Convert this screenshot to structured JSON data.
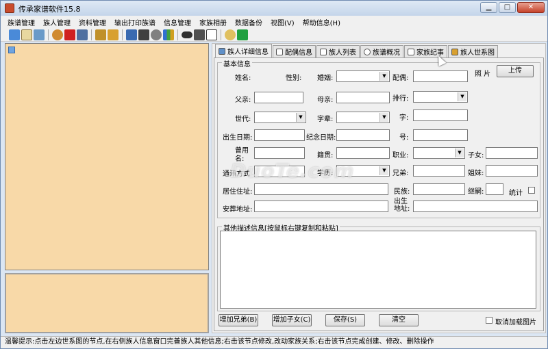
{
  "window": {
    "title": "传承家谱软件15.8",
    "minimize": "▁",
    "maximize": "□",
    "close": "✕"
  },
  "menu": [
    "族谱管理",
    "族人管理",
    "资料管理",
    "输出打印族谱",
    "信息管理",
    "家族相册",
    "数据备份",
    "视图(V)",
    "帮助信息(H)"
  ],
  "toolbar_icons": [
    "tree-icon",
    "book-icon",
    "page-icon",
    "add-person-icon",
    "delete-icon",
    "edit-icon",
    "link-icon",
    "people-icon",
    "print-icon",
    "binoculars-icon",
    "settings-icon",
    "chart-icon",
    "eye-icon",
    "books-icon",
    "letter-a-icon",
    "chat-icon",
    "exit-icon"
  ],
  "tabs": [
    "族人详细信息",
    "配偶信息",
    "族人列表",
    "族谱概况",
    "家族纪事",
    "族人世系图"
  ],
  "basic": {
    "group_title": "基本信息",
    "name": "姓名:",
    "gender": "性别:",
    "marriage": "婚姻:",
    "spouse": "配偶:",
    "photo": "照  片",
    "upload": "上传",
    "father": "父亲:",
    "mother": "母亲:",
    "rank": "排行:",
    "generation": "世代:",
    "generation_name": "字辈:",
    "courtesy": "字:",
    "birth": "出生日期:",
    "memorial": "纪念日期:",
    "alias": "号:",
    "former_name": "曾用名:",
    "native_place": "籍贯:",
    "occupation": "职业:",
    "children": "子女:",
    "contact": "通讯方式",
    "education": "学历:",
    "brothers": "兄弟:",
    "sisters": "姐妹:",
    "address": "居住住址:",
    "ethnicity": "民族:",
    "succession": "继嗣:",
    "stats": "统计",
    "burial": "安葬地址:",
    "birthplace": "出生地址:"
  },
  "other": {
    "group_title": "其他描述信息[按鼠标右键复制和粘贴]"
  },
  "buttons": {
    "add_sibling": "增加兄弟(B)",
    "add_child": "增加子女(C)",
    "save": "保存(S)",
    "clear": "清空",
    "cancel_photo": "取消加载图片"
  },
  "status": "温馨提示:点击左边世系图的节点,在右侧族人信息窗口完善族人其他信息;右击该节点修改,改动家族关系;右击该节点完成创建、修改、删除操作",
  "watermark": "DuoTe.com",
  "colors": {
    "pane": "#f8d9a8",
    "chrome": "#dbe6f3"
  }
}
